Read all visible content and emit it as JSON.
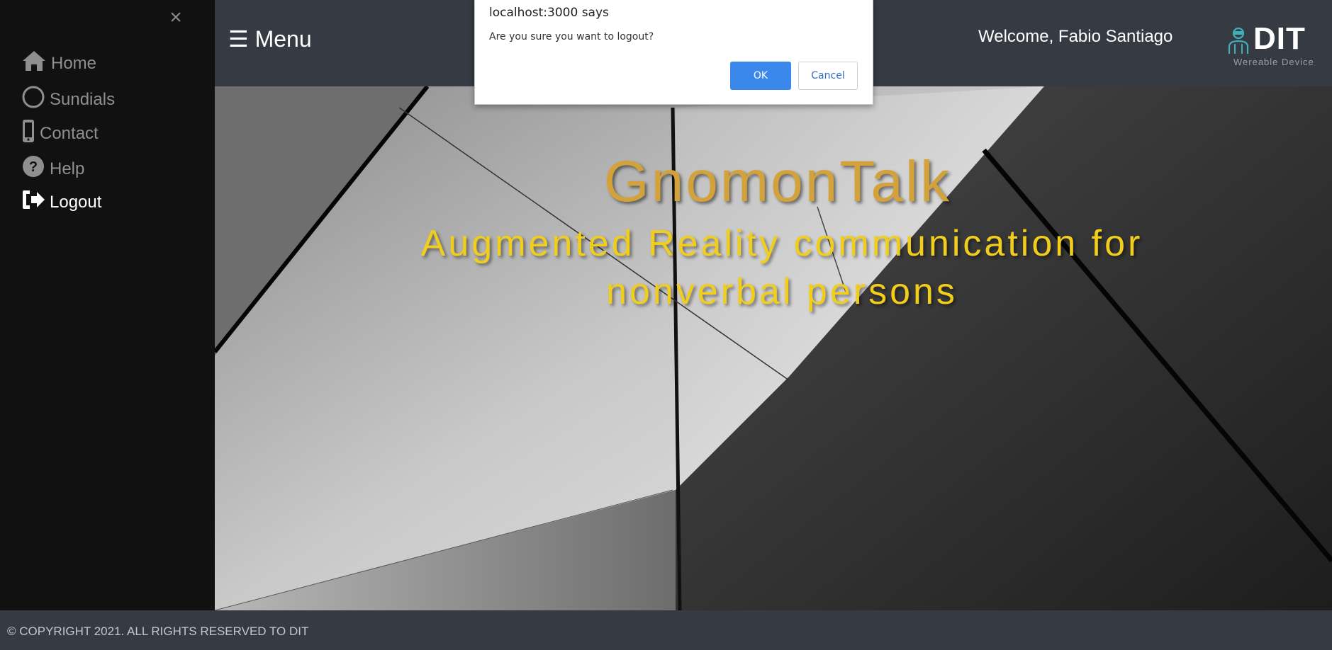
{
  "sidebar": {
    "close_icon": "×",
    "items": [
      {
        "label": "Home",
        "icon": "home-icon"
      },
      {
        "label": "Sundials",
        "icon": "circle-icon"
      },
      {
        "label": "Contact",
        "icon": "mobile-icon"
      },
      {
        "label": "Help",
        "icon": "question-circle-icon"
      },
      {
        "label": "Logout",
        "icon": "logout-icon",
        "active": true
      }
    ]
  },
  "header": {
    "menu_label": "☰ Menu",
    "welcome": "Welcome, Fabio Santiago",
    "logo": {
      "text": "DIT",
      "subtitle": "Wereable Device"
    }
  },
  "hero": {
    "title": "GnomonTalk",
    "subtitle": "Augmented Reality communication for nonverbal persons"
  },
  "footer": {
    "copyright": "© COPYRIGHT 2021. ALL RIGHTS RESERVED TO DIT"
  },
  "dialog": {
    "title": "localhost:3000 says",
    "message": "Are you sure you want to logout?",
    "ok_label": "OK",
    "cancel_label": "Cancel"
  },
  "colors": {
    "sidebar_bg": "#111111",
    "topbar_bg": "#353a43",
    "title_color": "#d4a23a",
    "subtitle_color": "#f2ce1c",
    "ok_button": "#3b88ec"
  }
}
